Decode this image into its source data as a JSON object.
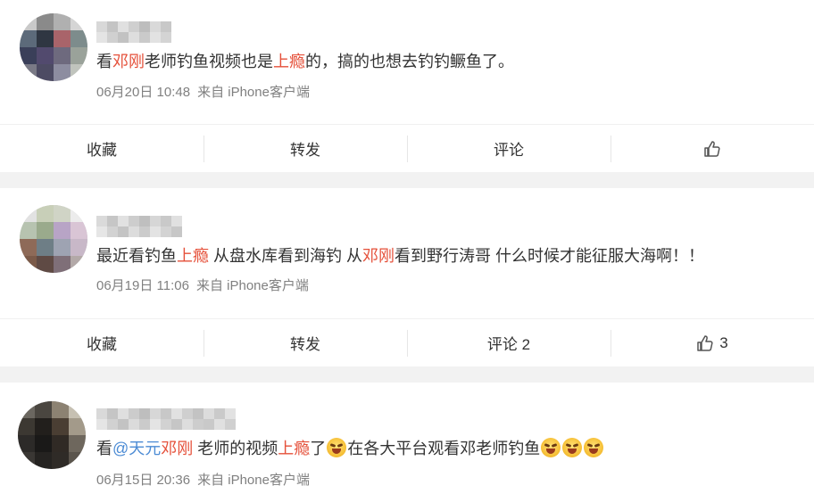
{
  "posts": [
    {
      "content": {
        "pre": "看",
        "kw1": "邓刚",
        "mid": "老师钓鱼视频也是",
        "kw2": "上瘾",
        "post": "的，搞的也想去钓钓鳜鱼了。"
      },
      "date": "06月20日 10:48",
      "source": "来自 iPhone客户端",
      "actions": {
        "collect": "收藏",
        "repost": "转发",
        "comment": "评论",
        "like_count": ""
      }
    },
    {
      "content": {
        "pre": "最近看钓鱼",
        "kw1": "上瘾",
        "mid": " 从盘水库看到海钓 从",
        "kw2": "邓刚",
        "post": "看到野行涛哥 什么时候才能征服大海啊！！"
      },
      "date": "06月19日 11:06",
      "source": "来自 iPhone客户端",
      "actions": {
        "collect": "收藏",
        "repost": "转发",
        "comment": "评论 2",
        "like_count": "3"
      }
    },
    {
      "content": {
        "pre": "看",
        "mention": "@天元",
        "kw1": "邓刚",
        "mid": " 老师的视频",
        "kw2": "上瘾",
        "post1": "了",
        "post2": "在各大平台观看邓老师钓鱼"
      },
      "date": "06月15日 20:36",
      "source": "来自 iPhone客户端"
    }
  ],
  "icons": {
    "like": "thumbs-up-icon",
    "emoji": "laugh-cry-emoji-icon"
  },
  "colors": {
    "keyword": "#e5503a",
    "mention": "#4c8bd4",
    "meta": "#808080",
    "separator": "#f2f2f2"
  }
}
